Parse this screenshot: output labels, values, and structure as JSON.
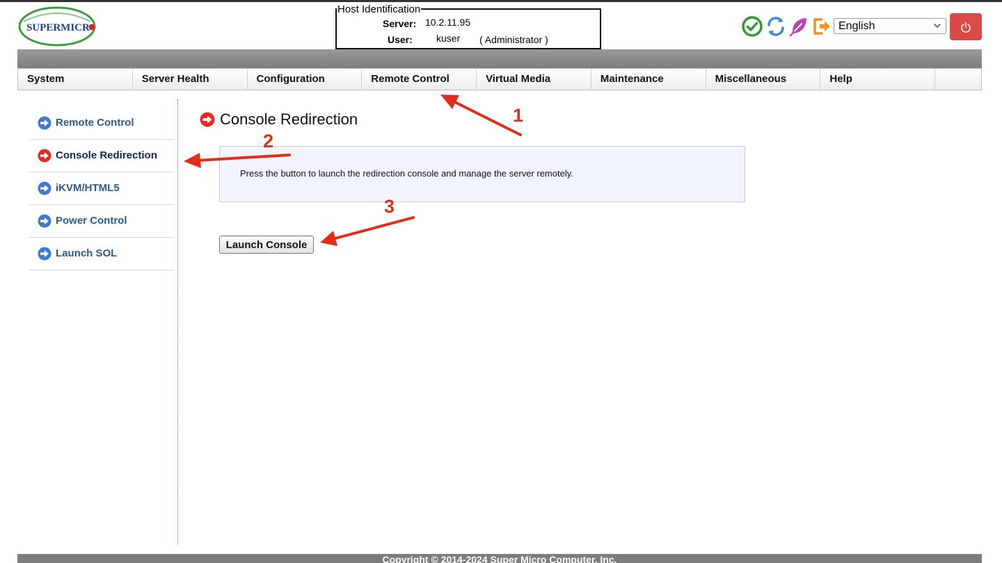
{
  "brand": {
    "logo_text": "SUPERMICR",
    "logo_dot_color": "#d9261c",
    "logo_text_color": "#1a3f93",
    "logo_ring_color": "#3a9d3f"
  },
  "host": {
    "legend": "Host Identification",
    "server_label": "Server:",
    "server_value": "10.2.11.95",
    "user_label": "User:",
    "user_value": "kuser",
    "user_role": "( Administrator )"
  },
  "toolbar": {
    "icons": [
      "check-circle-icon",
      "refresh-icon",
      "feather-icon",
      "logout-icon",
      "power-icon"
    ],
    "language_selected": "English",
    "power_color": "#dc4a45"
  },
  "nav": {
    "items": [
      {
        "label": "System"
      },
      {
        "label": "Server Health"
      },
      {
        "label": "Configuration"
      },
      {
        "label": "Remote Control"
      },
      {
        "label": "Virtual Media"
      },
      {
        "label": "Maintenance"
      },
      {
        "label": "Miscellaneous"
      },
      {
        "label": "Help"
      },
      {
        "label": ""
      }
    ]
  },
  "sidebar": {
    "items": [
      {
        "label": "Remote Control",
        "icon": "arrow-circle-blue-icon"
      },
      {
        "label": "Console Redirection",
        "icon": "arrow-circle-red-icon",
        "active": true
      },
      {
        "label": "iKVM/HTML5",
        "icon": "arrow-circle-blue-icon"
      },
      {
        "label": "Power Control",
        "icon": "arrow-circle-blue-icon"
      },
      {
        "label": "Launch SOL",
        "icon": "arrow-circle-blue-icon"
      }
    ]
  },
  "content": {
    "title": "Console Redirection",
    "info": "Press the button to launch the redirection console and manage the server remotely.",
    "launch_button": "Launch Console"
  },
  "annotations": {
    "numbers": [
      "1",
      "2",
      "3"
    ],
    "color": "#e22d1b"
  },
  "footer": {
    "text": "Copyright © 2014-2024 Super Micro Computer, Inc."
  }
}
